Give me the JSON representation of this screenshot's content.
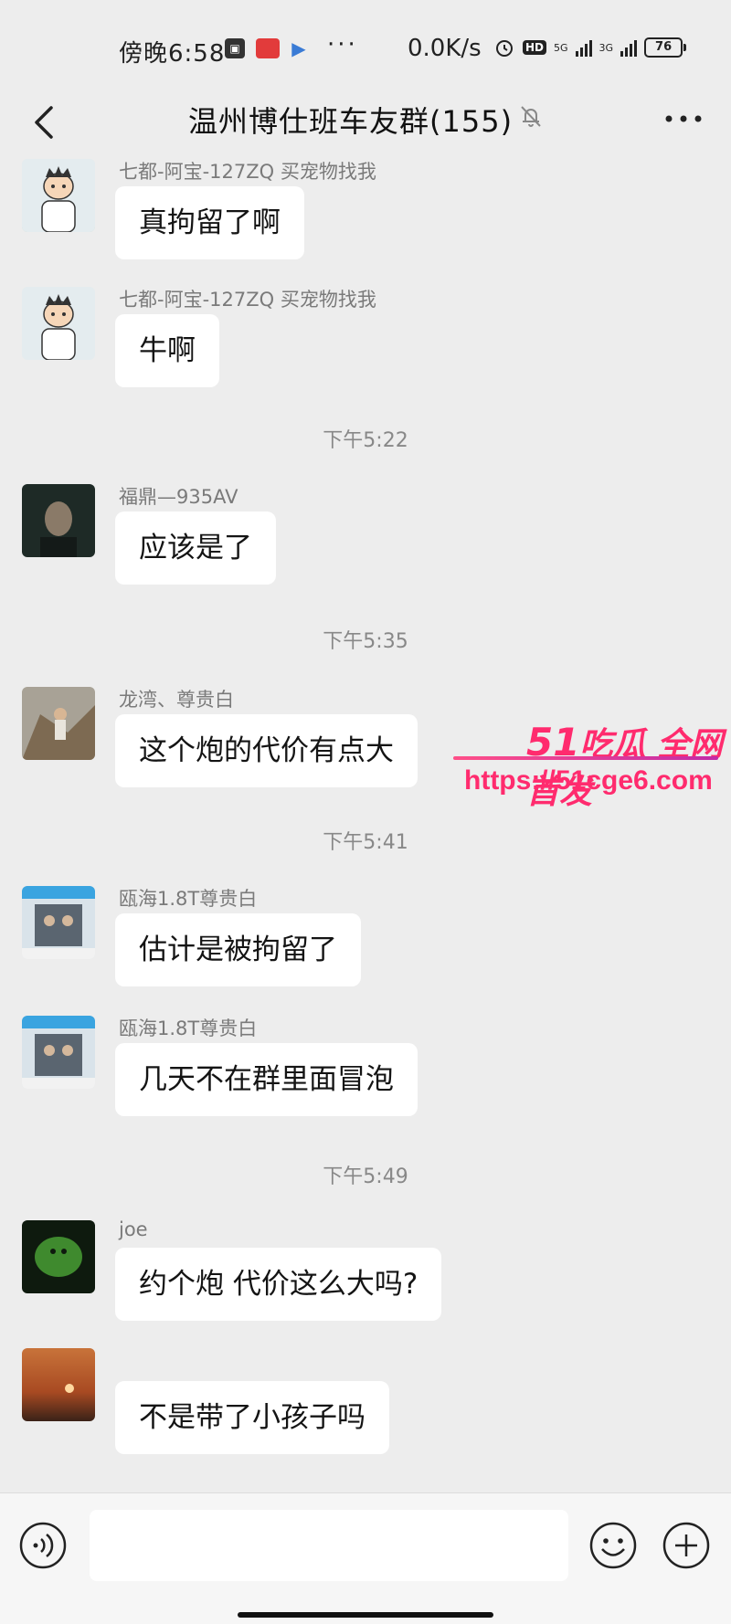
{
  "status_bar": {
    "time": "傍晚6:58",
    "app_icons": [
      "square-app-icon",
      "red-app-icon",
      "play-app-icon"
    ],
    "more": "···",
    "net_speed": "0.0K/s",
    "hd": "HD",
    "sim1": "5G",
    "sim2": "3G",
    "battery": "76"
  },
  "nav": {
    "title": "温州博仕班车友群(155)"
  },
  "messages": [
    {
      "sender": "七都-阿宝-127ZQ 买宠物找我",
      "text": "真拘留了啊"
    },
    {
      "sender": "七都-阿宝-127ZQ 买宠物找我",
      "text": "牛啊"
    },
    {
      "time": "下午5:22"
    },
    {
      "sender": "福鼎—935AV",
      "text": "应该是了"
    },
    {
      "time": "下午5:35"
    },
    {
      "sender": "龙湾、尊贵白",
      "text": "这个炮的代价有点大"
    },
    {
      "time": "下午5:41"
    },
    {
      "sender": "瓯海1.8T尊贵白",
      "text": "估计是被拘留了"
    },
    {
      "sender": "瓯海1.8T尊贵白",
      "text": "几天不在群里面冒泡"
    },
    {
      "time": "下午5:49"
    },
    {
      "sender": "joe",
      "text": "约个炮 代价这么大吗?"
    },
    {
      "sender": "",
      "text": "不是带了小孩子吗"
    }
  ],
  "watermark": {
    "brand_num": "51",
    "brand_text": "吃瓜 全网首发",
    "url": "https://51cge6.com"
  },
  "input": {
    "placeholder": ""
  },
  "colors": {
    "background": "#ededed",
    "bubble": "#ffffff",
    "watermark": "#ff2b6e"
  }
}
